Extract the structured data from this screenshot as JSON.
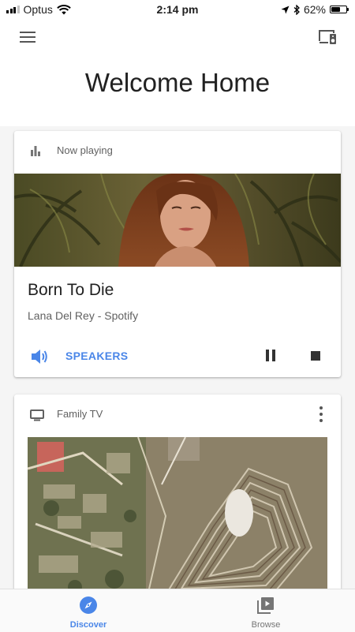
{
  "status_bar": {
    "carrier": "Optus",
    "time": "2:14 pm",
    "battery": "62%",
    "battery_level": 0.62
  },
  "header": {
    "title": "Welcome Home",
    "menu_icon": "hamburger-menu-icon",
    "cast_icon": "devices-cast-icon"
  },
  "now_playing": {
    "label": "Now playing",
    "track_title": "Born To Die",
    "track_subtitle": "Lana Del Rey - Spotify",
    "output_label": "SPEAKERS"
  },
  "family_tv": {
    "label": "Family TV"
  },
  "bottom_nav": {
    "discover": "Discover",
    "browse": "Browse"
  },
  "colors": {
    "accent": "#4a86e8",
    "icon_dark": "#333333",
    "text_secondary": "#616161"
  }
}
